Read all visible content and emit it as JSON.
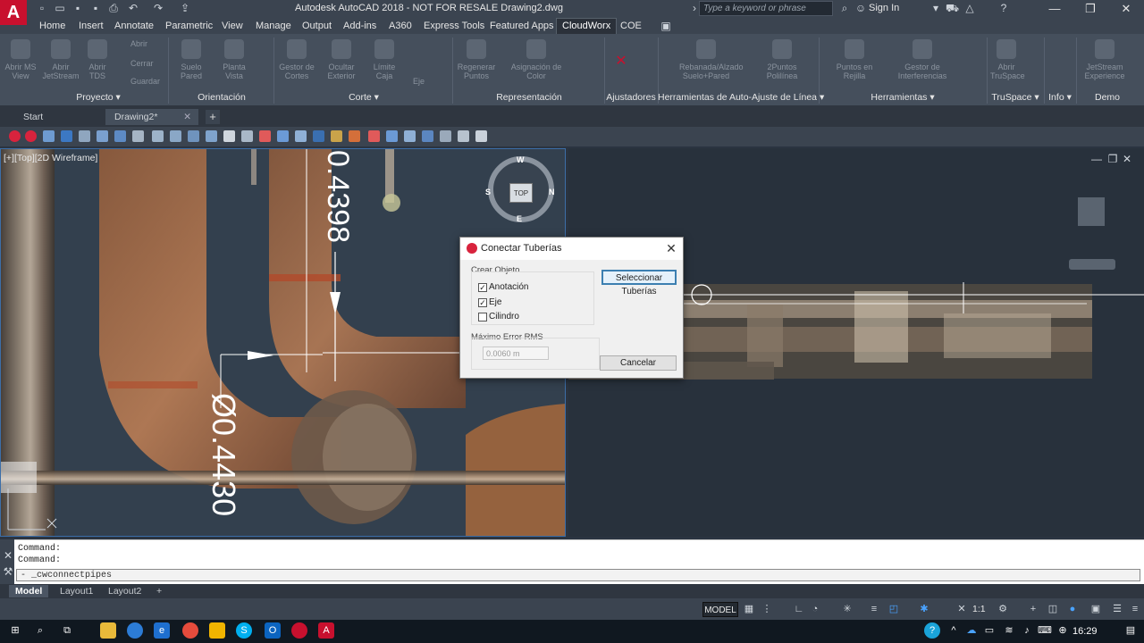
{
  "titlebar": {
    "title": "Autodesk AutoCAD 2018 - NOT FOR RESALE    Drawing2.dwg",
    "search_placeholder": "Type a keyword or phrase",
    "sign_in": "Sign In"
  },
  "ribbon_tabs": [
    "Home",
    "Insert",
    "Annotate",
    "Parametric",
    "View",
    "Manage",
    "Output",
    "Add-ins",
    "A360",
    "Express Tools",
    "Featured Apps",
    "CloudWorx",
    "COE"
  ],
  "ribbon_buttons": [
    {
      "label": "Abrir MS View"
    },
    {
      "label": "Abrir JetStream"
    },
    {
      "label": "Abrir TDS"
    },
    {
      "label": "Suelo Pared"
    },
    {
      "label": "Planta Vista"
    },
    {
      "label": "Gestor de Cortes"
    },
    {
      "label": "Ocultar Exterior"
    },
    {
      "label": "Límite Caja"
    },
    {
      "label": "Regenerar Puntos"
    },
    {
      "label": "Asignación de Color"
    },
    {
      "label": "Rebanada/Alzado Suelo+Pared"
    },
    {
      "label": "2Puntos Polilínea"
    },
    {
      "label": "Puntos en Rejilla"
    },
    {
      "label": "Gestor de Interferencias"
    },
    {
      "label": "Abrir TruSpace"
    },
    {
      "label": "JetStream Experience"
    }
  ],
  "ribbon_small": {
    "abrir": "Abrir",
    "cerrar": "Cerrar",
    "guardar": "Guardar",
    "eje": "Eje"
  },
  "ribbon_panels": [
    "Proyecto ▾",
    "Orientación",
    "Corte ▾",
    "Representación",
    "Ajustadores",
    "Herramientas de Auto-Ajuste de Línea ▾",
    "Herramientas ▾",
    "TruSpace ▾",
    "Info ▾",
    "Demo"
  ],
  "doc_tabs": {
    "start": "Start",
    "drawing": "Drawing2*"
  },
  "viewport": {
    "label": "[+][Top][2D Wireframe]",
    "dim_top": "0.4398",
    "dim_bottom": "Ø0.4430",
    "viewcube": {
      "top": "TOP",
      "n": "N",
      "s": "S",
      "e": "E",
      "w": "W"
    }
  },
  "dialog": {
    "title": "Conectar Tuberías",
    "group1": "Crear Objeto",
    "opt_anotacion": "Anotación",
    "opt_eje": "Eje",
    "opt_cilindro": "Cilindro",
    "group2": "Máximo Error RMS",
    "rms_value": "0.0060 m",
    "btn_select": "Seleccionar Tuberías",
    "btn_cancel": "Cancelar",
    "checks": {
      "anotacion": true,
      "eje": true,
      "cilindro": false
    }
  },
  "command": {
    "line1": "Command:",
    "line2": "Command:",
    "input": "- _cwconnectpipes"
  },
  "layout_tabs": [
    "Model",
    "Layout1",
    "Layout2"
  ],
  "status": {
    "model": "MODEL",
    "scale": "1:1"
  },
  "taskbar": {
    "clock": "16:29"
  }
}
